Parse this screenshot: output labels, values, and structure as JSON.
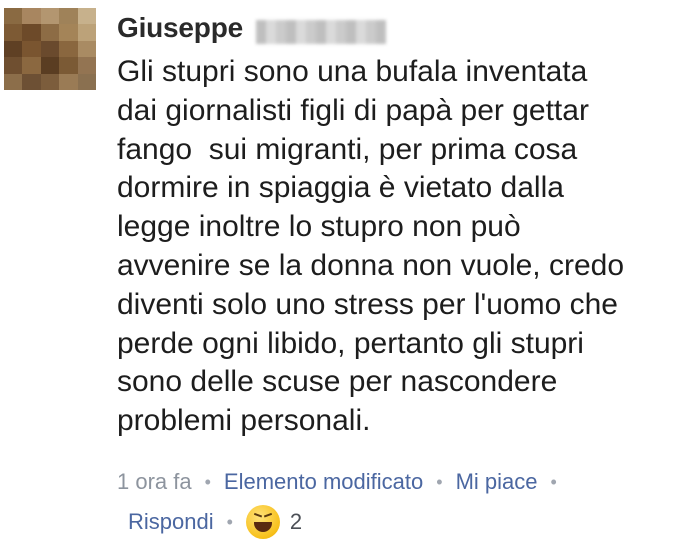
{
  "author": {
    "first_name": "Giuseppe"
  },
  "comment": {
    "lines": [
      "Gli stupri sono una bufala inventata",
      "dai giornalisti figli di papà per gettar",
      "fango  sui migranti, per prima cosa",
      "dormire in spiaggia è vietato dalla",
      "legge inoltre lo stupro non può",
      "avvenire se la donna non vuole, credo",
      "diventi solo uno stress per l'uomo che",
      "perde ogni libido, pertanto gli stupri",
      "sono delle scuse per nascondere",
      "problemi personali."
    ]
  },
  "meta": {
    "time": "1 ora fa",
    "edited": "Elemento modificato",
    "like": "Mi piace",
    "reply": "Rispondi",
    "separator": "•",
    "reaction_icon": "haha-reaction-icon",
    "reaction_count": "2"
  },
  "colors": {
    "link": "#4b67a1",
    "meta": "#8d949e",
    "text": "#1d1d1d"
  }
}
